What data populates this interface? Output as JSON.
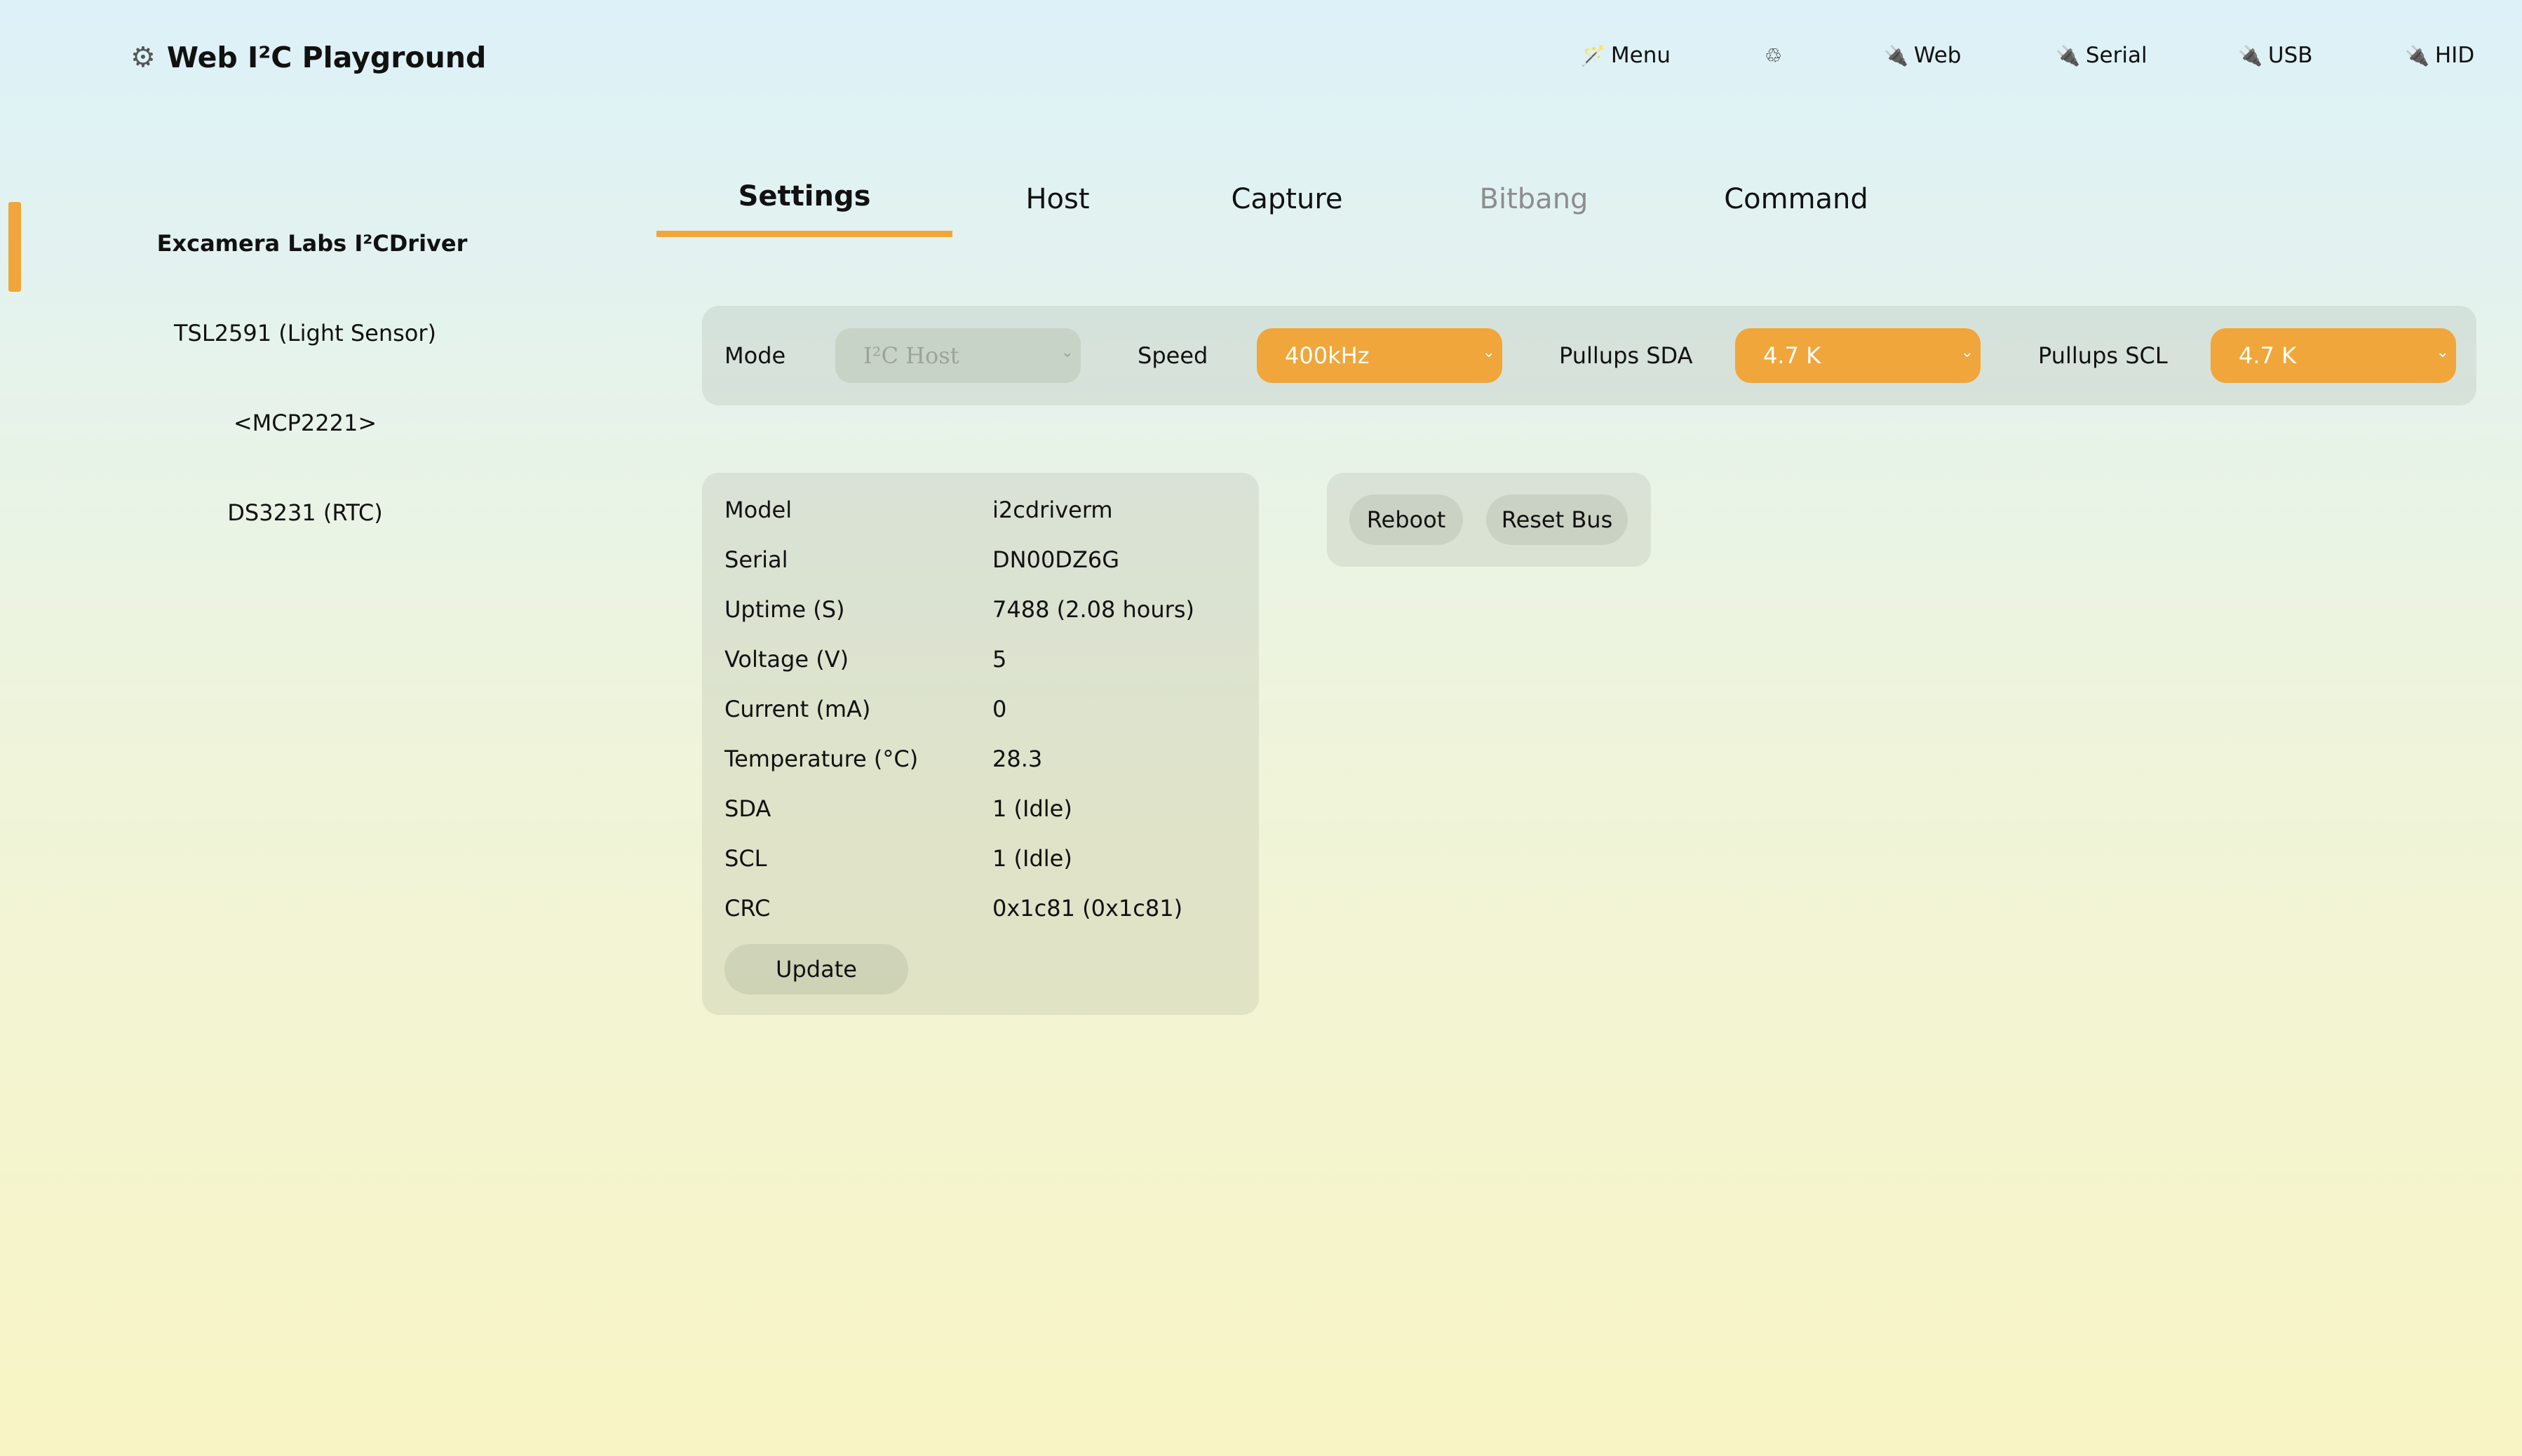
{
  "brand": {
    "title": "Web I²C Playground",
    "icon": "gear-icon"
  },
  "nav": {
    "menu": {
      "icon": "wand-icon",
      "label": "Menu"
    },
    "theme": {
      "icon": "recycle-icon",
      "glyph": "♲"
    },
    "web": {
      "icon": "plug-icon",
      "label": "Web"
    },
    "serial": {
      "icon": "plug-icon",
      "label": "Serial"
    },
    "usb": {
      "icon": "plug-icon",
      "label": "USB"
    },
    "hid": {
      "icon": "plug-icon",
      "label": "HID"
    }
  },
  "sidebar": {
    "items": [
      {
        "label": "Excamera Labs I²CDriver",
        "active": true
      },
      {
        "label": "TSL2591 (Light Sensor)"
      },
      {
        "label": "<MCP2221>"
      },
      {
        "label": "DS3231 (RTC)"
      }
    ]
  },
  "tabs": [
    {
      "label": "Settings",
      "active": true
    },
    {
      "label": "Host"
    },
    {
      "label": "Capture"
    },
    {
      "label": "Bitbang",
      "disabled": true
    },
    {
      "label": "Command"
    }
  ],
  "settings": {
    "mode_label": "Mode",
    "mode_value": "I²C Host",
    "speed_label": "Speed",
    "speed_value": "400kHz",
    "sda_label": "Pullups SDA",
    "sda_value": "4.7 K",
    "scl_label": "Pullups SCL",
    "scl_value": "4.7 K"
  },
  "info": {
    "rows": [
      {
        "key": "Model",
        "value": "i2cdriverm"
      },
      {
        "key": "Serial",
        "value": "DN00DZ6G"
      },
      {
        "key": "Uptime (S)",
        "value": "7488 (2.08 hours)"
      },
      {
        "key": "Voltage (V)",
        "value": "5"
      },
      {
        "key": "Current (mA)",
        "value": "0"
      },
      {
        "key": "Temperature (°C)",
        "value": "28.3"
      },
      {
        "key": "SDA",
        "value": "1 (Idle)"
      },
      {
        "key": "SCL",
        "value": "1 (Idle)"
      },
      {
        "key": "CRC",
        "value": "0x1c81 (0x1c81)"
      }
    ],
    "update_label": "Update"
  },
  "actions": {
    "reboot_label": "Reboot",
    "reset_label": "Reset Bus"
  },
  "colors": {
    "accent": "#f0a63a",
    "disabled_text": "#8d8d8d"
  }
}
